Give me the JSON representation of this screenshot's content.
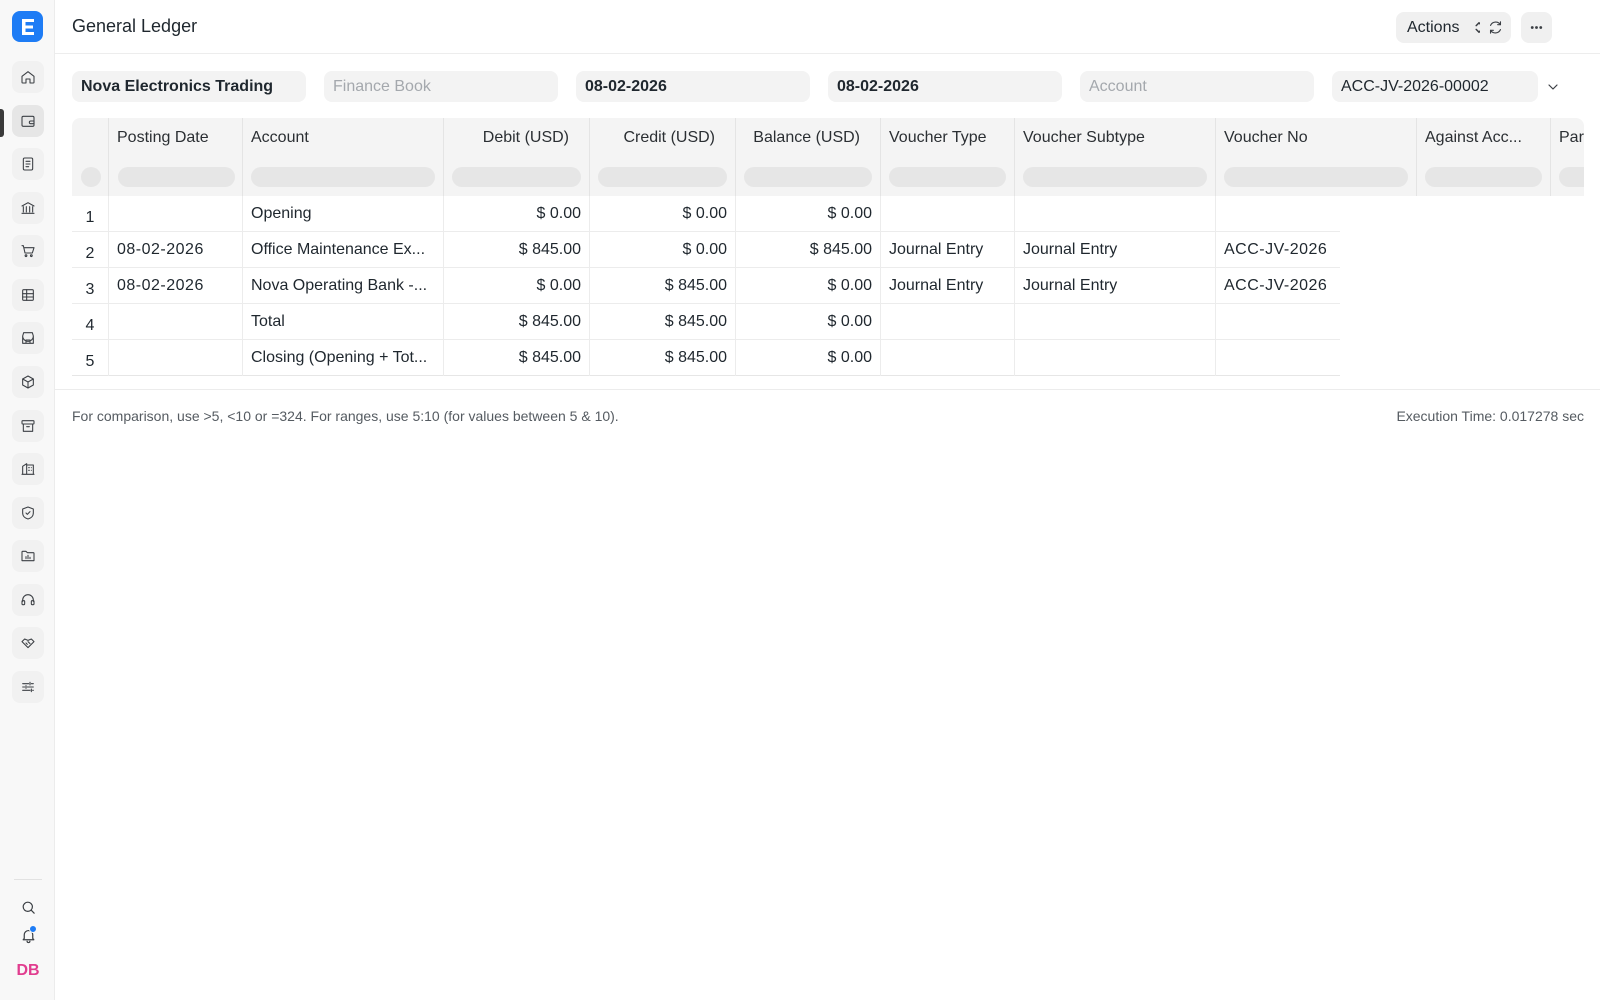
{
  "header": {
    "title": "General Ledger",
    "actions_label": "Actions"
  },
  "filters": {
    "company": "Nova Electronics Trading",
    "finance_book_placeholder": "Finance Book",
    "from_date": "08-02-2026",
    "to_date": "08-02-2026",
    "account_placeholder": "Account",
    "voucher_no": "ACC-JV-2026-00002"
  },
  "table": {
    "columns": [
      "Posting Date",
      "Account",
      "Debit (USD)",
      "Credit (USD)",
      "Balance (USD)",
      "Voucher Type",
      "Voucher Subtype",
      "Voucher No",
      "Against Acc...",
      "Par"
    ],
    "rows": [
      {
        "idx": "1",
        "posting_date": "",
        "account": "Opening",
        "debit": "$ 0.00",
        "credit": "$ 0.00",
        "balance": "$ 0.00",
        "voucher_type": "",
        "voucher_subtype": "",
        "voucher_no": ""
      },
      {
        "idx": "2",
        "posting_date": "08-02-2026",
        "account": "Office Maintenance Ex...",
        "debit": "$ 845.00",
        "credit": "$ 0.00",
        "balance": "$ 845.00",
        "voucher_type": "Journal Entry",
        "voucher_subtype": "Journal Entry",
        "voucher_no": "ACC-JV-2026"
      },
      {
        "idx": "3",
        "posting_date": "08-02-2026",
        "account": "Nova Operating Bank -...",
        "debit": "$ 0.00",
        "credit": "$ 845.00",
        "balance": "$ 0.00",
        "voucher_type": "Journal Entry",
        "voucher_subtype": "Journal Entry",
        "voucher_no": "ACC-JV-2026"
      },
      {
        "idx": "4",
        "posting_date": "",
        "account": "Total",
        "debit": "$ 845.00",
        "credit": "$ 845.00",
        "balance": "$ 0.00",
        "voucher_type": "",
        "voucher_subtype": "",
        "voucher_no": ""
      },
      {
        "idx": "5",
        "posting_date": "",
        "account": "Closing (Opening + Tot...",
        "debit": "$ 845.00",
        "credit": "$ 845.00",
        "balance": "$ 0.00",
        "voucher_type": "",
        "voucher_subtype": "",
        "voucher_no": ""
      }
    ]
  },
  "footer": {
    "help_text": "For comparison, use >5, <10 or =324. For ranges, use 5:10 (for values between 5 & 10).",
    "execution_time": "Execution Time: 0.017278 sec"
  },
  "user": {
    "initials": "DB"
  },
  "colors": {
    "brand": "#1e7cf5",
    "avatar_text": "#e13d8f"
  },
  "sidebar_icons": [
    "home-icon",
    "wallet-icon",
    "document-icon",
    "bank-icon",
    "cart-icon",
    "table-icon",
    "store-icon",
    "package-icon",
    "archive-icon",
    "building-icon",
    "shield-icon",
    "folder-chart-icon",
    "headset-icon",
    "handshake-icon",
    "sliders-icon"
  ]
}
